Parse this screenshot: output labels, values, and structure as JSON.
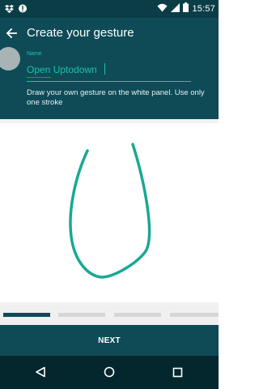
{
  "status_bar": {
    "time": "15:57",
    "icons": [
      "dropbox-icon",
      "notification-icon",
      "wifi-icon",
      "cellular-signal-icon",
      "battery-icon"
    ]
  },
  "header": {
    "title": "Create your gesture",
    "back_icon": "arrow-left-icon"
  },
  "form": {
    "name_label": "Name",
    "name_value": "Open Uptodown",
    "help_text": "Draw your own gesture on the white panel. Use only one stroke"
  },
  "colors": {
    "header_bg": "#0e4b57",
    "accent": "#21c0a8",
    "stroke": "#1aa894",
    "status_bg": "#0b3d47",
    "nav_bg": "#04262d"
  },
  "steps": {
    "total": 4,
    "active_index": 0
  },
  "footer": {
    "next_label": "NEXT"
  },
  "nav": {
    "buttons": [
      "back-triangle-icon",
      "home-circle-icon",
      "recents-square-icon"
    ]
  }
}
